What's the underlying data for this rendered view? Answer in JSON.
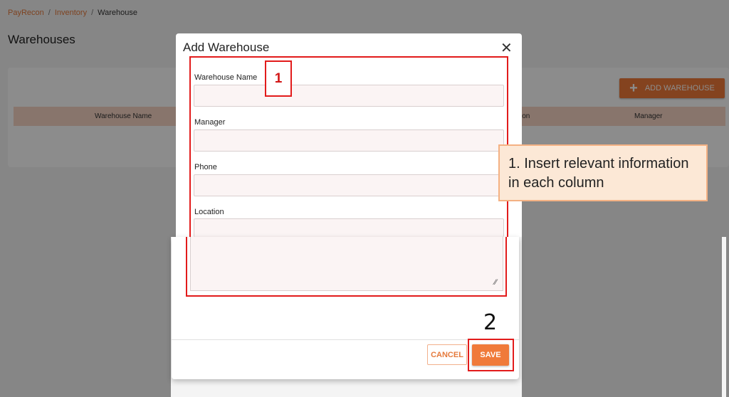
{
  "breadcrumb": {
    "items": [
      "PayRecon",
      "Inventory",
      "Warehouse"
    ]
  },
  "page": {
    "title": "Warehouses"
  },
  "toolbar": {
    "add_label": "ADD WAREHOUSE"
  },
  "table": {
    "headers": [
      "Warehouse Name",
      "ion",
      "Manager"
    ]
  },
  "modal": {
    "title": "Add Warehouse",
    "fields": {
      "warehouse_name": {
        "label": "Warehouse Name",
        "value": ""
      },
      "manager": {
        "label": "Manager",
        "value": ""
      },
      "phone": {
        "label": "Phone",
        "value": ""
      },
      "location": {
        "label": "Location",
        "value": ""
      }
    },
    "cancel_label": "CANCEL",
    "save_label": "SAVE"
  },
  "annotations": {
    "marker1": "1",
    "marker2": "2",
    "callout_text": "1. Insert relevant information in each column"
  },
  "colors": {
    "accent": "#f07a3a",
    "annotation_red": "#e21b1b",
    "callout_bg": "#fce8d6"
  }
}
